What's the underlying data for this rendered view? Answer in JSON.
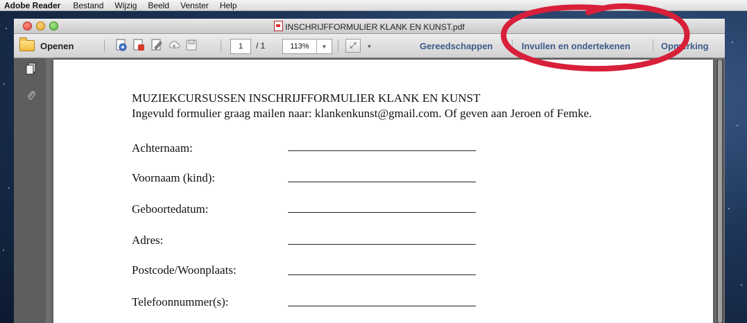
{
  "menubar": {
    "app_name": "Adobe Reader",
    "items": [
      "Bestand",
      "Wijzig",
      "Beeld",
      "Venster",
      "Help"
    ]
  },
  "window": {
    "title": "INSCHRIJFFORMULIER KLANK EN KUNST.pdf"
  },
  "toolbar": {
    "open_label": "Openen",
    "page_current": "1",
    "page_total": "/ 1",
    "zoom": "113%",
    "tools_label": "Gereedschappen",
    "fill_sign_label": "Invullen en ondertekenen",
    "comment_label": "Opmerking"
  },
  "document": {
    "title": "MUZIEKCURSUSSEN INSCHRIJFFORMULIER KLANK EN KUNST",
    "subtitle": "Ingevuld formulier graag mailen naar: klankenkunst@gmail.com.  Of geven aan Jeroen of Femke.",
    "fields": [
      {
        "label": "Achternaam:"
      },
      {
        "label": "Voornaam (kind):"
      },
      {
        "label": "Geboortedatum:"
      },
      {
        "label": "Adres:"
      },
      {
        "label": "Postcode/Woonplaats:"
      },
      {
        "label": "Telefoonnummer(s):"
      }
    ]
  },
  "annotation": {
    "color": "#d8203a"
  }
}
